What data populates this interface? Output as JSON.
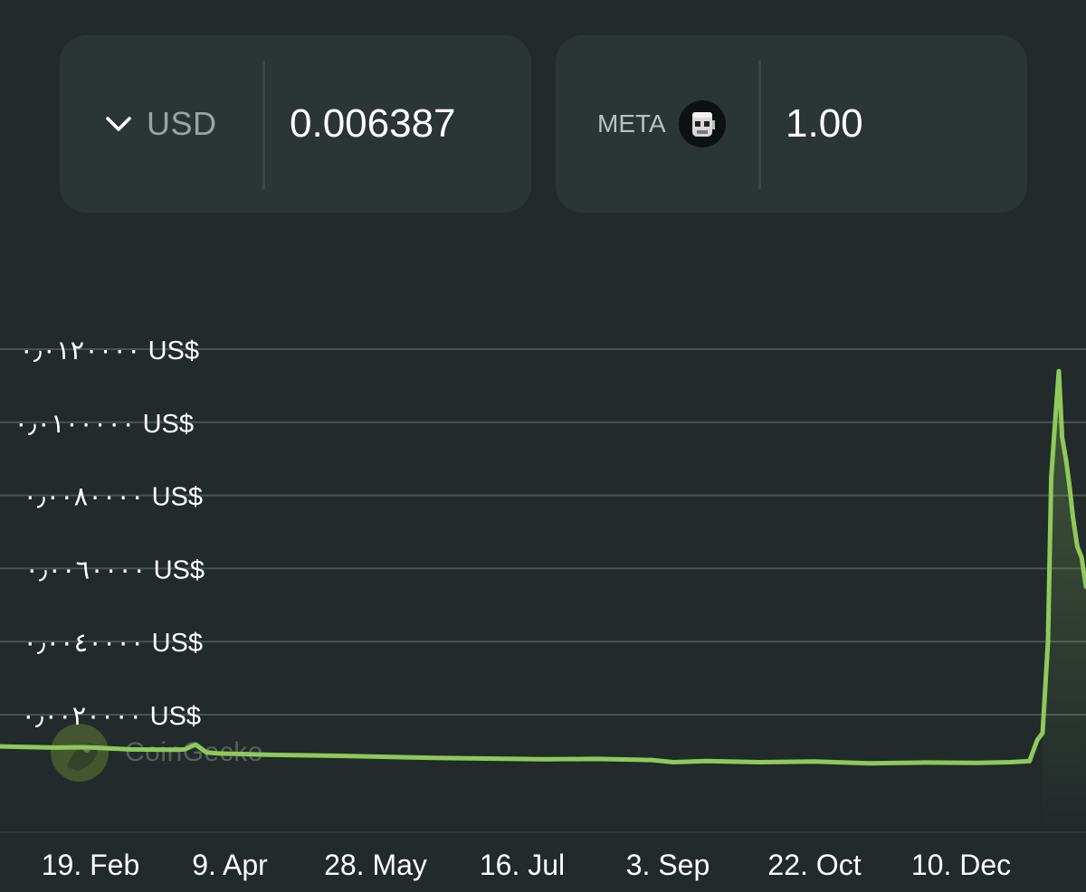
{
  "converter": {
    "from": {
      "currency": "USD",
      "amount": "0.006387",
      "dropdown_icon": "chevron-down-icon"
    },
    "to": {
      "currency": "META",
      "token_icon": "meta-token-icon",
      "amount": "1.00"
    }
  },
  "watermark": {
    "text": "CoinGecko",
    "logo_icon": "coingecko-logo"
  },
  "colors": {
    "background": "#222a2b",
    "card": "#2c3536",
    "line": "#8fc95a",
    "grid": "#4a5354"
  },
  "chart_data": {
    "type": "line",
    "y_tick_labels": [
      "٠٫٠٠٢٠٠٠٠ US$",
      "٠٫٠٠٤٠٠٠٠ US$",
      "٠٫٠٠٦٠٠٠٠ US$",
      "٠٫٠٠٨٠٠٠٠ US$",
      "٠٫٠١٠٠٠٠٠ US$",
      "٠٫٠١٢٠٠٠٠ US$"
    ],
    "y_ticks": [
      0.002,
      0.004,
      0.006,
      0.008,
      0.01,
      0.012
    ],
    "ylim": [
      0,
      0.0135
    ],
    "x_tick_labels": [
      "19. Feb",
      "9. Apr",
      "28. May",
      "16. Jul",
      "3. Sep",
      "22. Oct",
      "10. Dec"
    ],
    "xlabel": "",
    "ylabel": "",
    "grid": true,
    "series": [
      {
        "x": [
          0,
          0.02,
          0.05,
          0.08,
          0.12,
          0.16,
          0.17,
          0.18,
          0.19,
          0.2,
          0.25,
          0.3,
          0.4,
          0.5,
          0.55,
          0.6,
          0.62,
          0.65,
          0.7,
          0.75,
          0.8,
          0.85,
          0.9,
          0.93,
          0.948,
          0.955,
          0.96,
          0.965,
          0.968,
          0.972,
          0.975,
          0.978,
          0.982,
          0.985,
          0.988,
          0.992,
          0.996,
          1.0
        ],
        "y": [
          0.00113,
          0.00112,
          0.0011,
          0.00111,
          0.00105,
          0.00104,
          0.00105,
          0.00118,
          0.00097,
          0.00094,
          0.0009,
          0.00088,
          0.00082,
          0.00078,
          0.00079,
          0.00076,
          0.0007,
          0.00073,
          0.0007,
          0.00072,
          0.00067,
          0.00069,
          0.00068,
          0.0007,
          0.00073,
          0.0013,
          0.0015,
          0.004,
          0.0085,
          0.0102,
          0.0114,
          0.0096,
          0.0089,
          0.0082,
          0.0074,
          0.0066,
          0.0063,
          0.0055
        ]
      }
    ]
  }
}
